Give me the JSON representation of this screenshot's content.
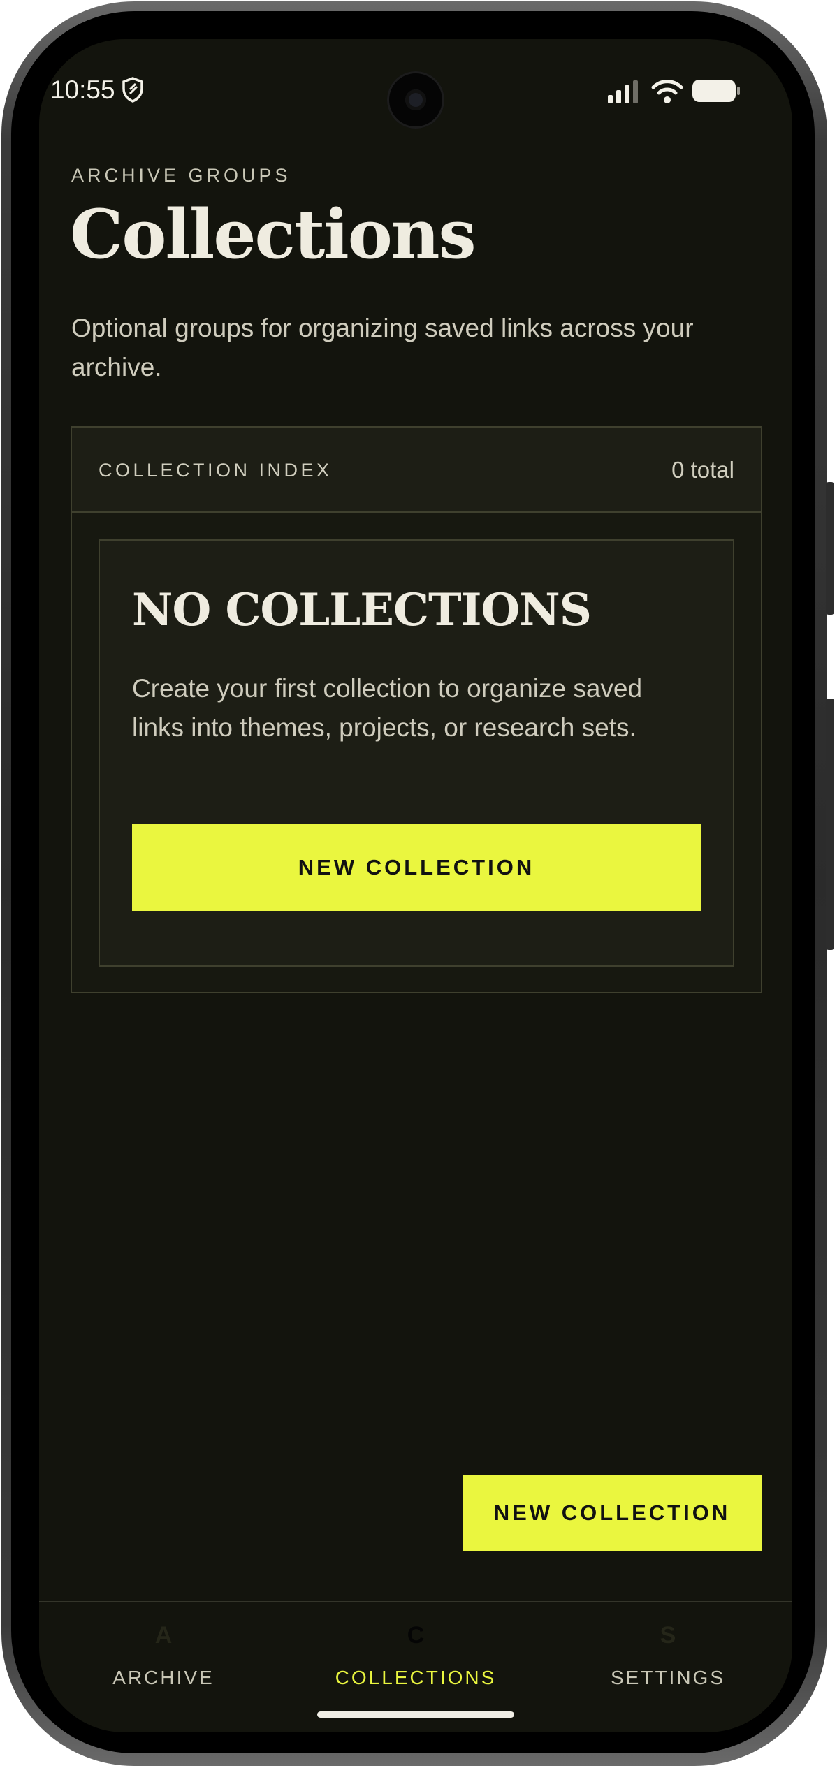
{
  "status_bar": {
    "time": "10:55",
    "icons": [
      "shield-icon",
      "signal-icon",
      "wifi-icon",
      "battery-icon"
    ]
  },
  "header": {
    "eyebrow": "ARCHIVE GROUPS",
    "title": "Collections",
    "subtitle": "Optional groups for organizing saved links across your archive."
  },
  "panel": {
    "label": "COLLECTION INDEX",
    "count": "0 total",
    "empty_state": {
      "title": "NO COLLECTIONS",
      "text": "Create your first collection to organize saved links into themes, projects, or research sets.",
      "button_label": "NEW COLLECTION"
    }
  },
  "fab": {
    "label": "NEW COLLECTION"
  },
  "nav": {
    "items": [
      {
        "glyph": "A",
        "label": "ARCHIVE",
        "active": false
      },
      {
        "glyph": "C",
        "label": "COLLECTIONS",
        "active": true
      },
      {
        "glyph": "S",
        "label": "SETTINGS",
        "active": false
      }
    ]
  },
  "colors": {
    "background": "#13140d",
    "accent": "#eaf63f",
    "text": "#efece0",
    "border": "#3f402e"
  }
}
